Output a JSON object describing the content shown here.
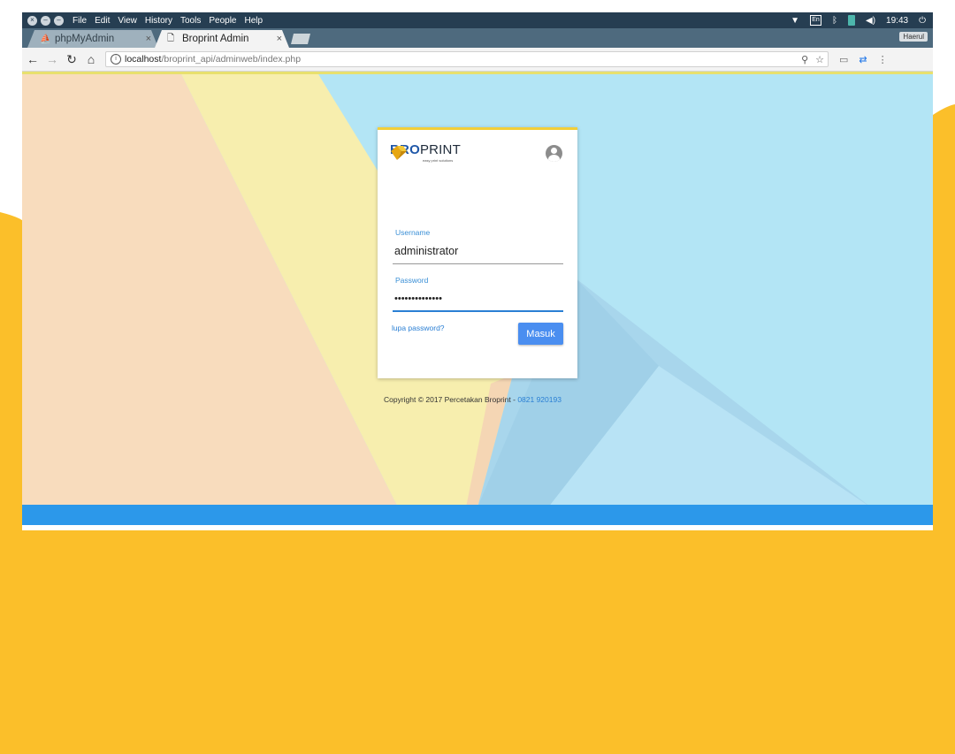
{
  "os_menubar": {
    "menu_items": [
      "File",
      "Edit",
      "View",
      "History",
      "Tools",
      "People",
      "Help"
    ],
    "keyboard_layout": "En",
    "clock": "19:43"
  },
  "browser": {
    "tabs": [
      {
        "label": "phpMyAdmin",
        "active": false
      },
      {
        "label": "Broprint Admin",
        "active": true
      }
    ],
    "profile_name": "Haerul",
    "url_host": "localhost",
    "url_path": "/broprint_api/adminweb/index.php"
  },
  "login": {
    "logo_bro": "BRO",
    "logo_print": "PRINT",
    "logo_tagline": "easy print solutions",
    "username_label": "Username",
    "username_value": "administrator",
    "password_label": "Password",
    "password_value": "••••••••••••••",
    "forgot_link": "lupa password?",
    "submit_label": "Masuk"
  },
  "footer": {
    "copyright_text": "Copyright © 2017 Percetakan Broprint - ",
    "phone": "0821 920193"
  },
  "colors": {
    "background_yellow": "#fbbf2a",
    "page_blue": "#b3e5f5",
    "footer_blue": "#2c98ea",
    "accent_blue": "#2a7fd4"
  }
}
